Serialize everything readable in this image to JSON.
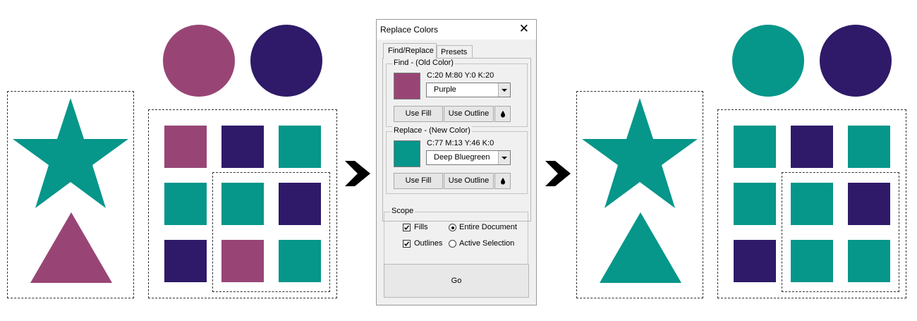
{
  "colors": {
    "purple": "#984576",
    "navy": "#2e1a68",
    "teal": "#06968a"
  },
  "dialog": {
    "title": "Replace Colors",
    "close_icon": "close-icon",
    "tabs": [
      {
        "label": "Find/Replace",
        "active": true
      },
      {
        "label": "Presets",
        "active": false
      }
    ],
    "find": {
      "group_label": "Find - (Old Color)",
      "cmyk": "C:20  M:80  Y:0  K:20",
      "swatch_color": "#984576",
      "color_name": "Purple",
      "use_fill": "Use Fill",
      "use_outline": "Use Outline",
      "eyedropper_icon": "eyedropper-icon"
    },
    "replace": {
      "group_label": "Replace - (New Color)",
      "cmyk": "C:77  M:13  Y:46  K:0",
      "swatch_color": "#06968a",
      "color_name": "Deep Bluegreen",
      "use_fill": "Use Fill",
      "use_outline": "Use Outline",
      "eyedropper_icon": "eyedropper-icon"
    },
    "scope": {
      "group_label": "Scope",
      "fills_label": "Fills",
      "fills_checked": true,
      "outlines_label": "Outlines",
      "outlines_checked": true,
      "entire_document_label": "Entire Document",
      "active_selection_label": "Active Selection",
      "selected_scope": "Entire Document"
    },
    "go_label": "Go"
  }
}
